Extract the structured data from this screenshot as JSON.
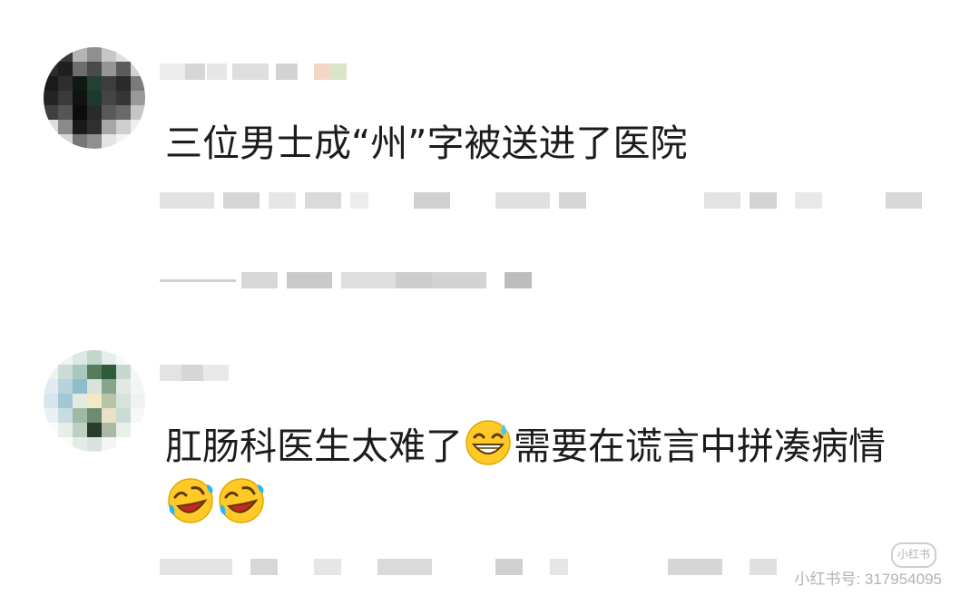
{
  "comments": [
    {
      "text": "三位男士成“州”字被送进了医院"
    },
    {
      "text_before": "肛肠科医生太难了",
      "emoji_1": "grinning-sweat-emoji",
      "text_after": "需要在谎言中拼凑病情",
      "emoji_2": "rolling-laughing-emoji",
      "emoji_3": "rolling-laughing-emoji"
    }
  ],
  "watermark": {
    "logo_text": "小红书",
    "id_text": "小红书号: 317954095"
  },
  "colors": {
    "text": "#1c1c1c",
    "background": "#ffffff",
    "blur_gray": "#d8d8d8"
  }
}
